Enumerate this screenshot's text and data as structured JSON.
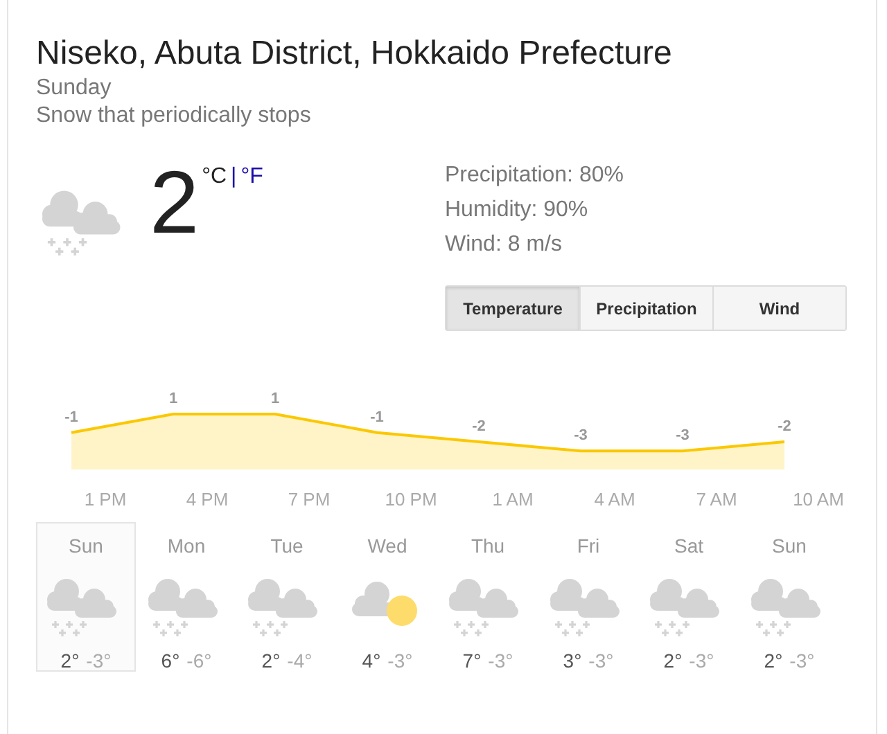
{
  "location": "Niseko, Abuta District, Hokkaido Prefecture",
  "day": "Sunday",
  "condition": "Snow that periodically stops",
  "current": {
    "kind": "snow",
    "temperature": "2",
    "units": [
      {
        "label": "°C",
        "selected": true
      },
      {
        "label": "°F",
        "selected": false
      }
    ],
    "separator": "|"
  },
  "details": [
    "Precipitation: 80%",
    "Humidity: 90%",
    "Wind: 8 m/s"
  ],
  "tabs": [
    {
      "label": "Temperature",
      "selected": true
    },
    {
      "label": "Precipitation",
      "selected": false
    },
    {
      "label": "Wind",
      "selected": false
    }
  ],
  "chart": {
    "chart_data": {
      "type": "area",
      "categories": [
        null,
        null,
        "1 PM",
        null,
        null,
        "4 PM",
        null,
        null,
        "7 PM",
        null,
        null,
        "10 PM",
        null,
        null,
        "1 AM",
        null,
        null,
        "4 AM",
        null,
        null,
        "7 AM",
        null,
        null,
        "10 AM",
        null
      ],
      "series": [
        {
          "color": "#fbc800",
          "values": [
            null,
            -1,
            null,
            null,
            1,
            null,
            null,
            1,
            null,
            null,
            -1,
            null,
            null,
            -2,
            null,
            null,
            -3,
            null,
            null,
            -3,
            null,
            null,
            -2,
            null,
            null
          ]
        }
      ],
      "data_labels": true
    }
  },
  "days": [
    {
      "name": "Sun",
      "kind": "snow",
      "high": "2°",
      "low": "-3°",
      "selected": true
    },
    {
      "name": "Mon",
      "kind": "snow",
      "high": "6°",
      "low": "-6°",
      "selected": false
    },
    {
      "name": "Tue",
      "kind": "snow",
      "high": "2°",
      "low": "-4°",
      "selected": false
    },
    {
      "name": "Wed",
      "kind": "sun",
      "high": "4°",
      "low": "-3°",
      "selected": false
    },
    {
      "name": "Thu",
      "kind": "snow",
      "high": "7°",
      "low": "-3°",
      "selected": false
    },
    {
      "name": "Fri",
      "kind": "snow",
      "high": "3°",
      "low": "-3°",
      "selected": false
    },
    {
      "name": "Sat",
      "kind": "snow",
      "high": "2°",
      "low": "-3°",
      "selected": false
    },
    {
      "name": "Sun",
      "kind": "snow",
      "high": "2°",
      "low": "-3°",
      "selected": false
    }
  ]
}
